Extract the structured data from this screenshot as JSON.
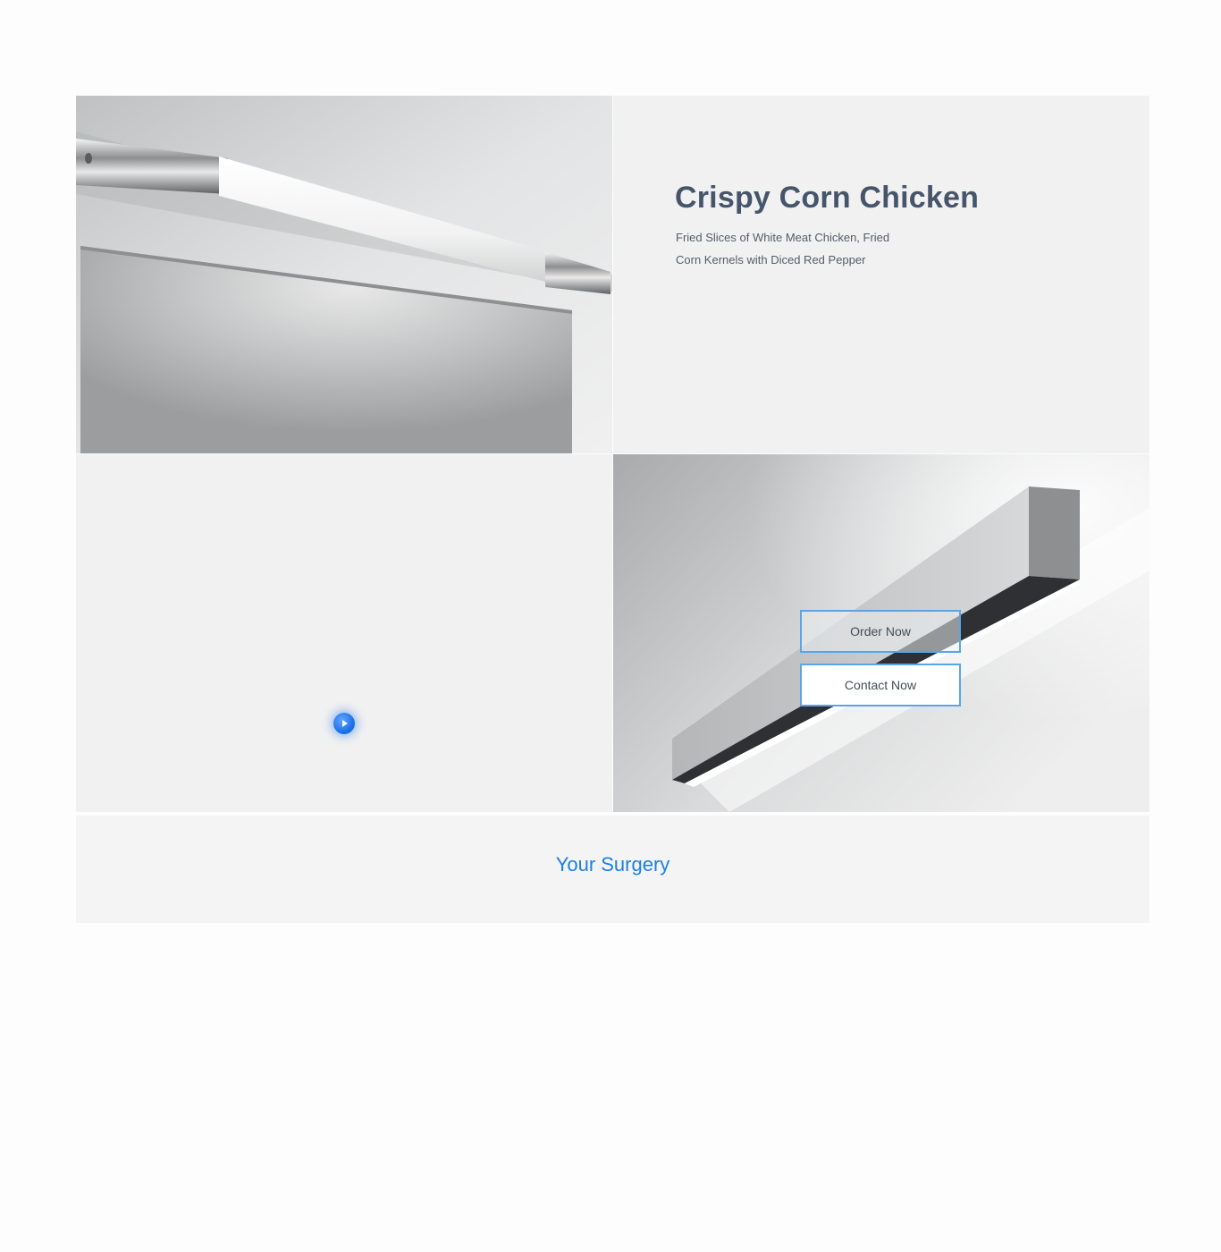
{
  "product": {
    "title": "Crispy Corn Chicken",
    "description_line1": "Fried Slices of White Meat Chicken, Fried",
    "description_line2": "Corn Kernels with Diced Red Pepper"
  },
  "media": {
    "photo_top_left": "tube-wall-light-over-mirror",
    "photo_bottom_right": "linear-wall-light",
    "play_icon": "play-icon"
  },
  "actions": {
    "order_label": "Order Now",
    "contact_label": "Contact Now"
  },
  "footer": {
    "title": "Your Surgery"
  },
  "colors": {
    "title": "#46556a",
    "accent_blue": "#1f7ee3",
    "button_border": "#5aa5e8",
    "panel_bg": "#f1f1f1"
  }
}
